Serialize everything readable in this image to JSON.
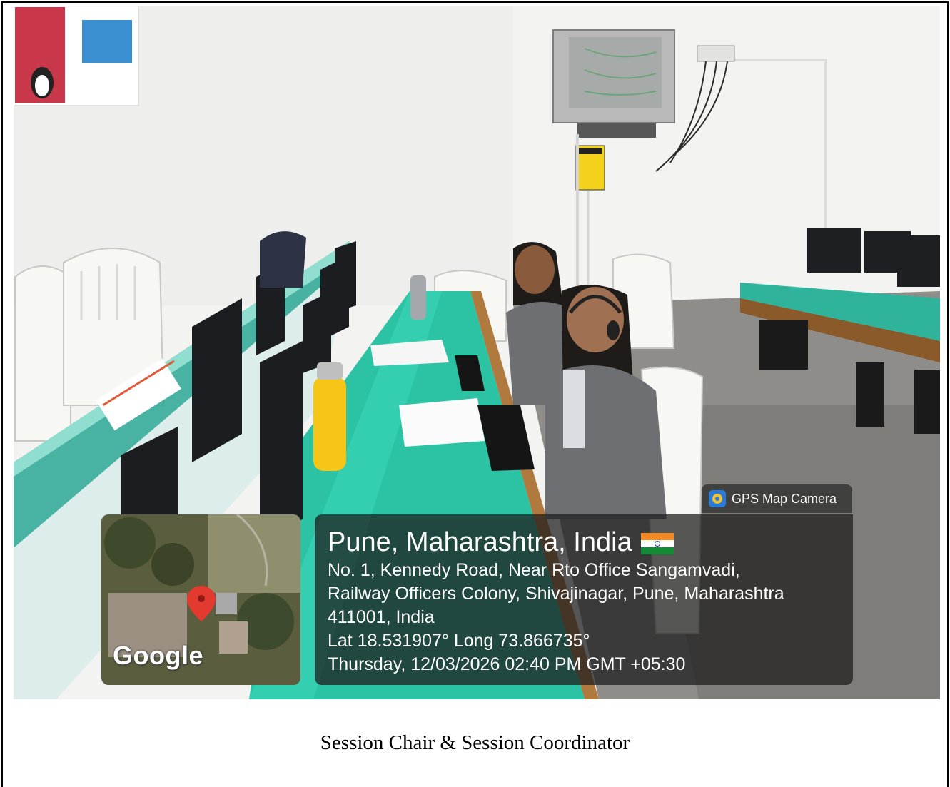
{
  "gps_badge": {
    "label": "GPS Map Camera",
    "icon": "camera-app-icon"
  },
  "location": {
    "title": "Pune, Maharashtra, India",
    "flag": "india-flag-icon",
    "address_line1": "No. 1, Kennedy Road, Near Rto Office Sangamvadi,",
    "address_line2": "Railway Officers Colony, Shivajinagar, Pune, Maharashtra",
    "address_line3": "411001, India",
    "coordinates": "Lat 18.531907° Long 73.866735°",
    "timestamp": "Thursday, 12/03/2026 02:40 PM GMT +05:30"
  },
  "map": {
    "logo_text": "Google",
    "pin_icon": "map-pin-icon",
    "pin_color": "#e23a2e"
  },
  "caption": "Session Chair & Session Coordinator",
  "colors": {
    "desk": "#2cc2a4",
    "wall": "#f3f3f1",
    "floor": "#8f8d8a",
    "jacket": "#6e6f73"
  }
}
